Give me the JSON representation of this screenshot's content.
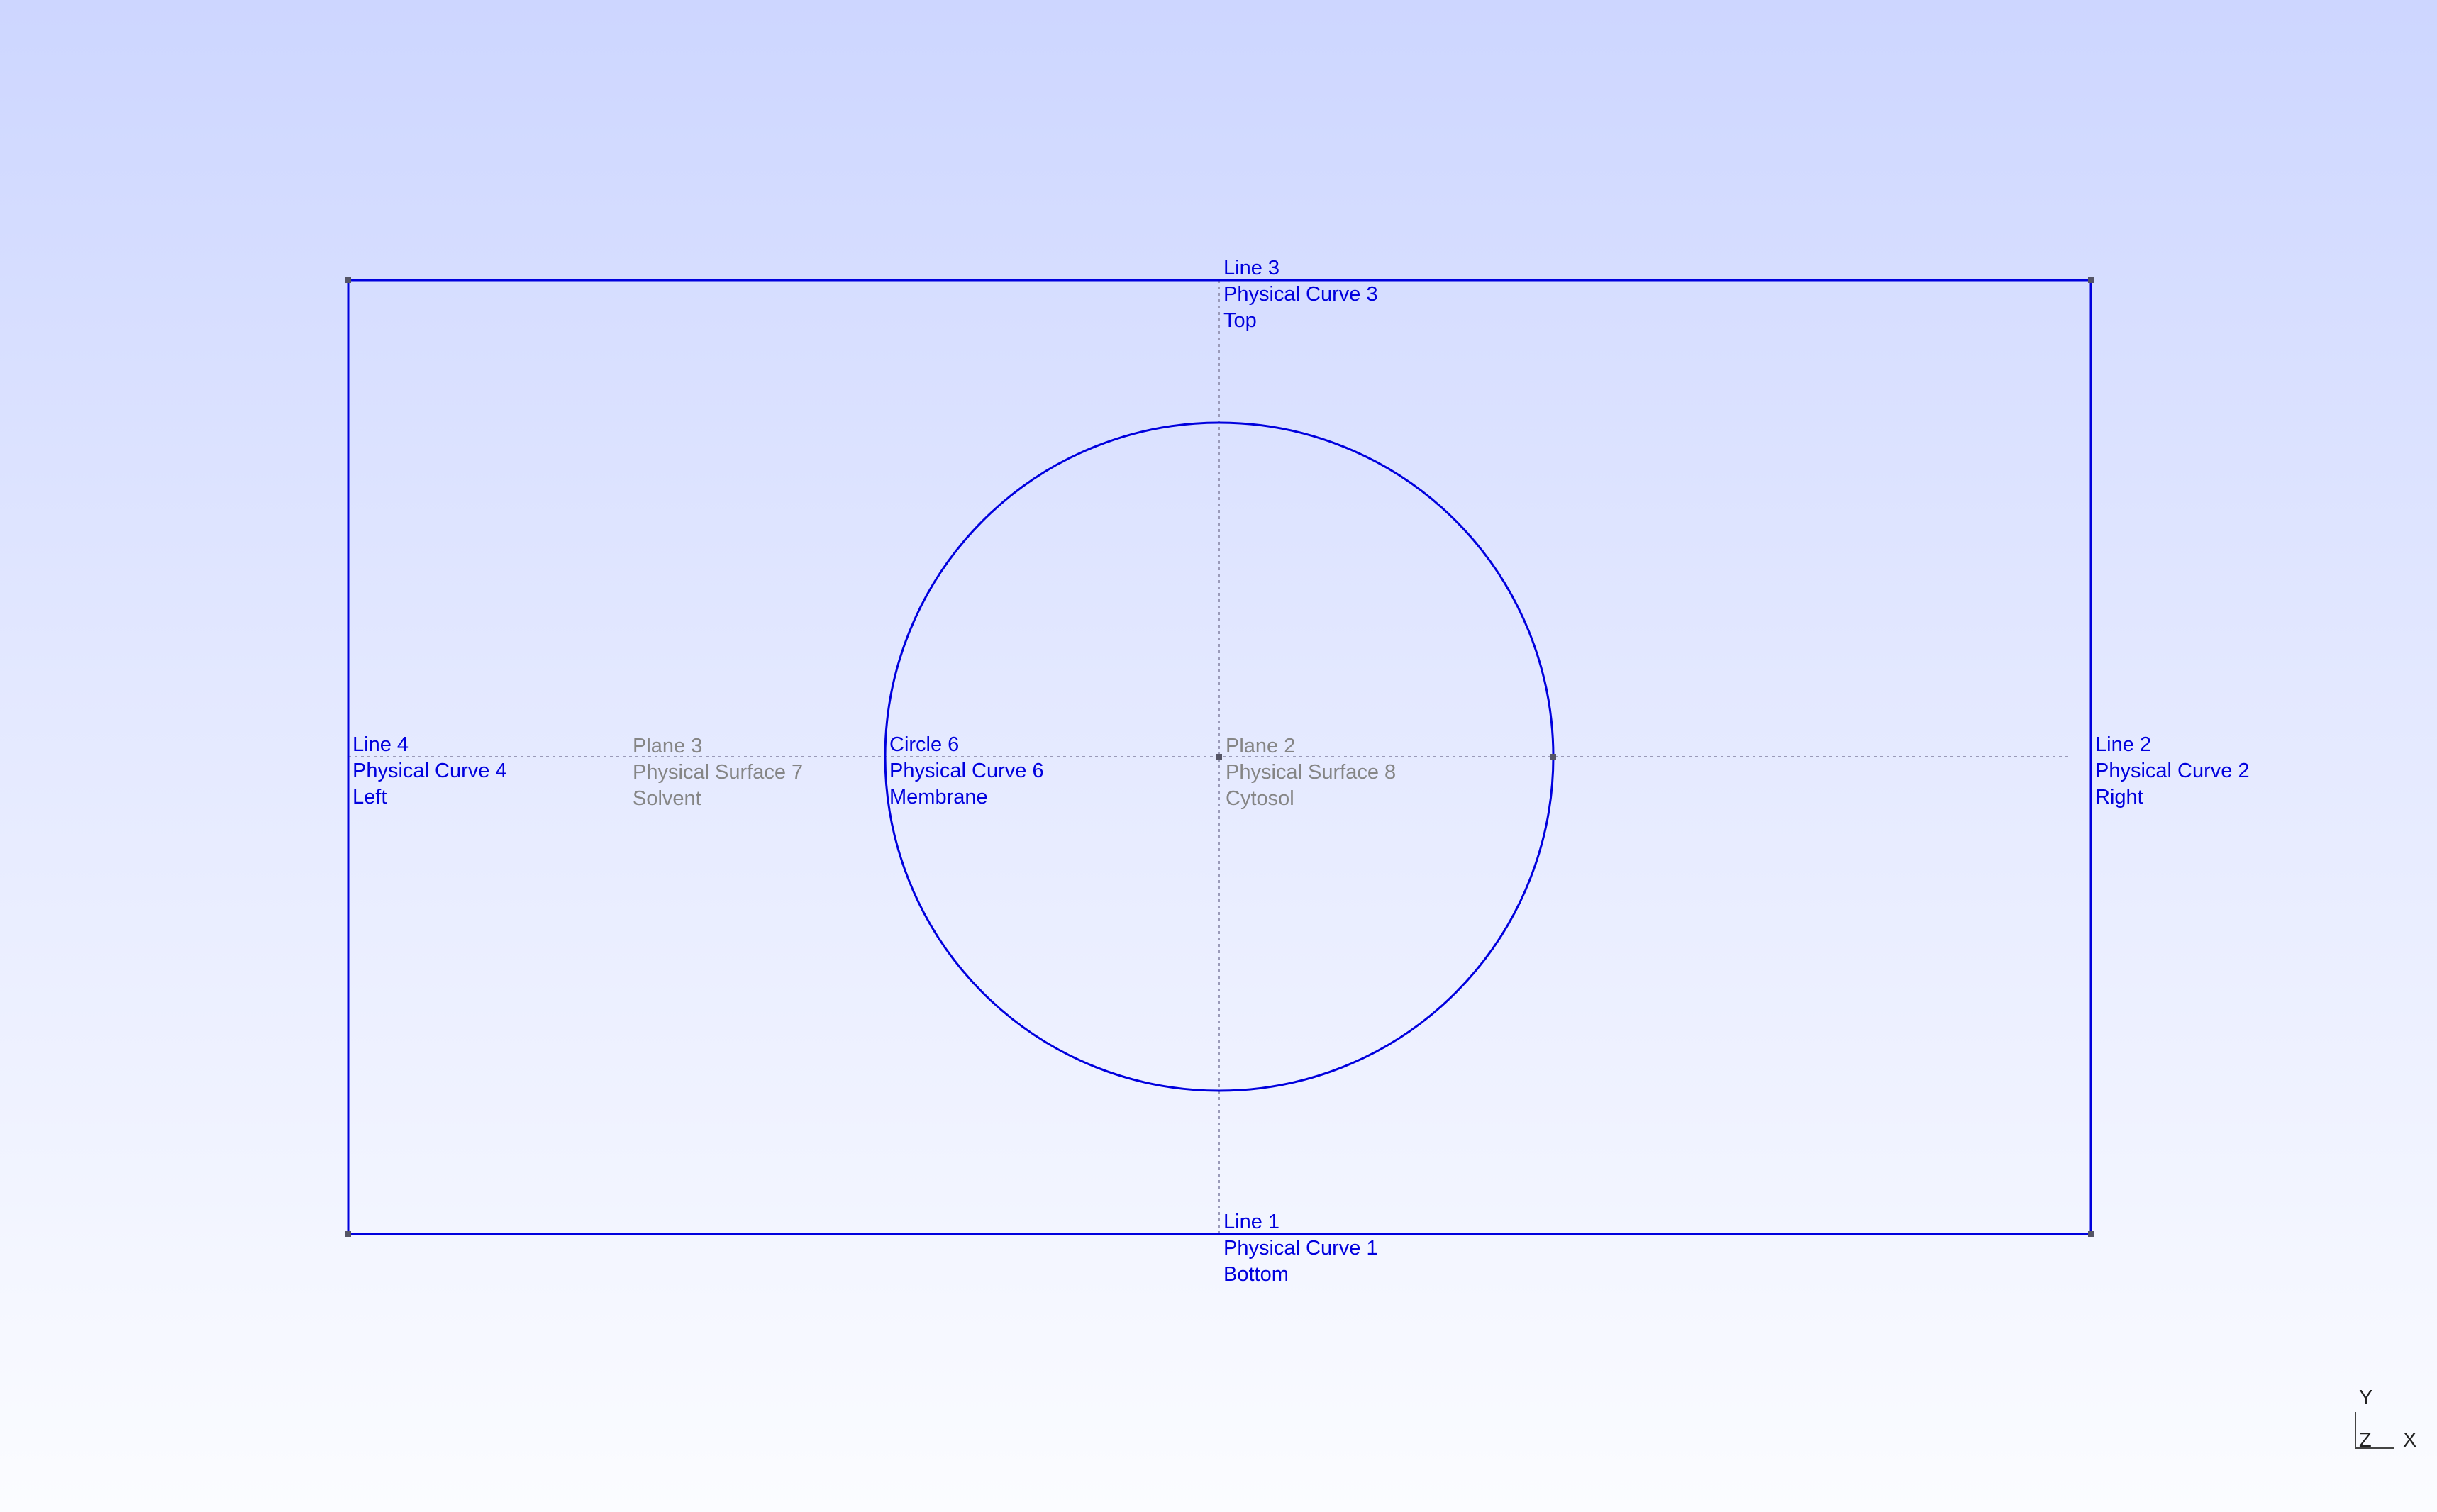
{
  "colors": {
    "curve": "#0000dd",
    "surface_label": "#858585",
    "dashed_line": "#9a9ab8",
    "point": "#555566",
    "bg_top": "#cdd6ff",
    "bg_bottom": "#fbfcff"
  },
  "labels": {
    "line3": {
      "name": "Line 3",
      "physical": "Physical Curve 3",
      "tag": "Top"
    },
    "line1": {
      "name": "Line 1",
      "physical": "Physical Curve 1",
      "tag": "Bottom"
    },
    "line4": {
      "name": "Line 4",
      "physical": "Physical Curve 4",
      "tag": "Left"
    },
    "line2": {
      "name": "Line 2",
      "physical": "Physical Curve 2",
      "tag": "Right"
    },
    "circle6": {
      "name": "Circle 6",
      "physical": "Physical Curve 6",
      "tag": "Membrane"
    },
    "plane3": {
      "name": "Plane 3",
      "physical": "Physical Surface 7",
      "tag": "Solvent"
    },
    "plane2": {
      "name": "Plane 2",
      "physical": "Physical Surface 8",
      "tag": "Cytosol"
    }
  },
  "axes": {
    "y": "Y",
    "z": "Z",
    "x": "X"
  }
}
